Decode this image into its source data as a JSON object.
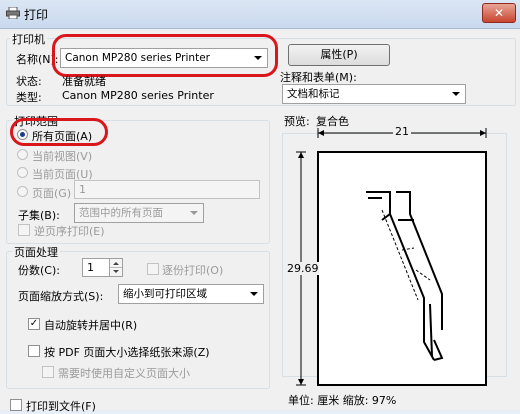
{
  "window": {
    "title": "打印",
    "close_label": "✕"
  },
  "printer": {
    "group_title": "打印机",
    "name_label": "名称(N):",
    "name_value": "Canon MP280 series Printer",
    "properties_button": "属性(P)",
    "status_label": "状态:",
    "status_value": "准备就绪",
    "type_label": "类型:",
    "type_value": "Canon MP280 series Printer",
    "comments_label": "注释和表单(M):",
    "comments_value": "文档和标记"
  },
  "range": {
    "group_title": "打印范围",
    "all_pages": "所有页面(A)",
    "current_view": "当前视图(V)",
    "current_page": "当前页面(U)",
    "pages": "页面(G)",
    "pages_value": "1",
    "subset_label": "子集(B):",
    "subset_value": "范围中的所有页面",
    "reverse": "逆页序打印(E)"
  },
  "handling": {
    "group_title": "页面处理",
    "copies_label": "份数(C):",
    "copies_value": "1",
    "collate": "逐份打印(O)",
    "scaling_label": "页面缩放方式(S):",
    "scaling_value": "缩小到可打印区域",
    "auto_rotate": "自动旋转并居中(R)",
    "choose_paper": "按 PDF 页面大小选择纸张来源(Z)",
    "custom_paper": "需要时使用自定义页面大小"
  },
  "print_to_file": "打印到文件(F)",
  "preview": {
    "label": "预览:",
    "mode": "复合色",
    "width_value": "21",
    "height_value": "29.69",
    "units_text": "单位: 厘米  缩放:  97%"
  },
  "colors": {
    "highlight": "#d8161b",
    "group_border": "#d5dfe5"
  }
}
